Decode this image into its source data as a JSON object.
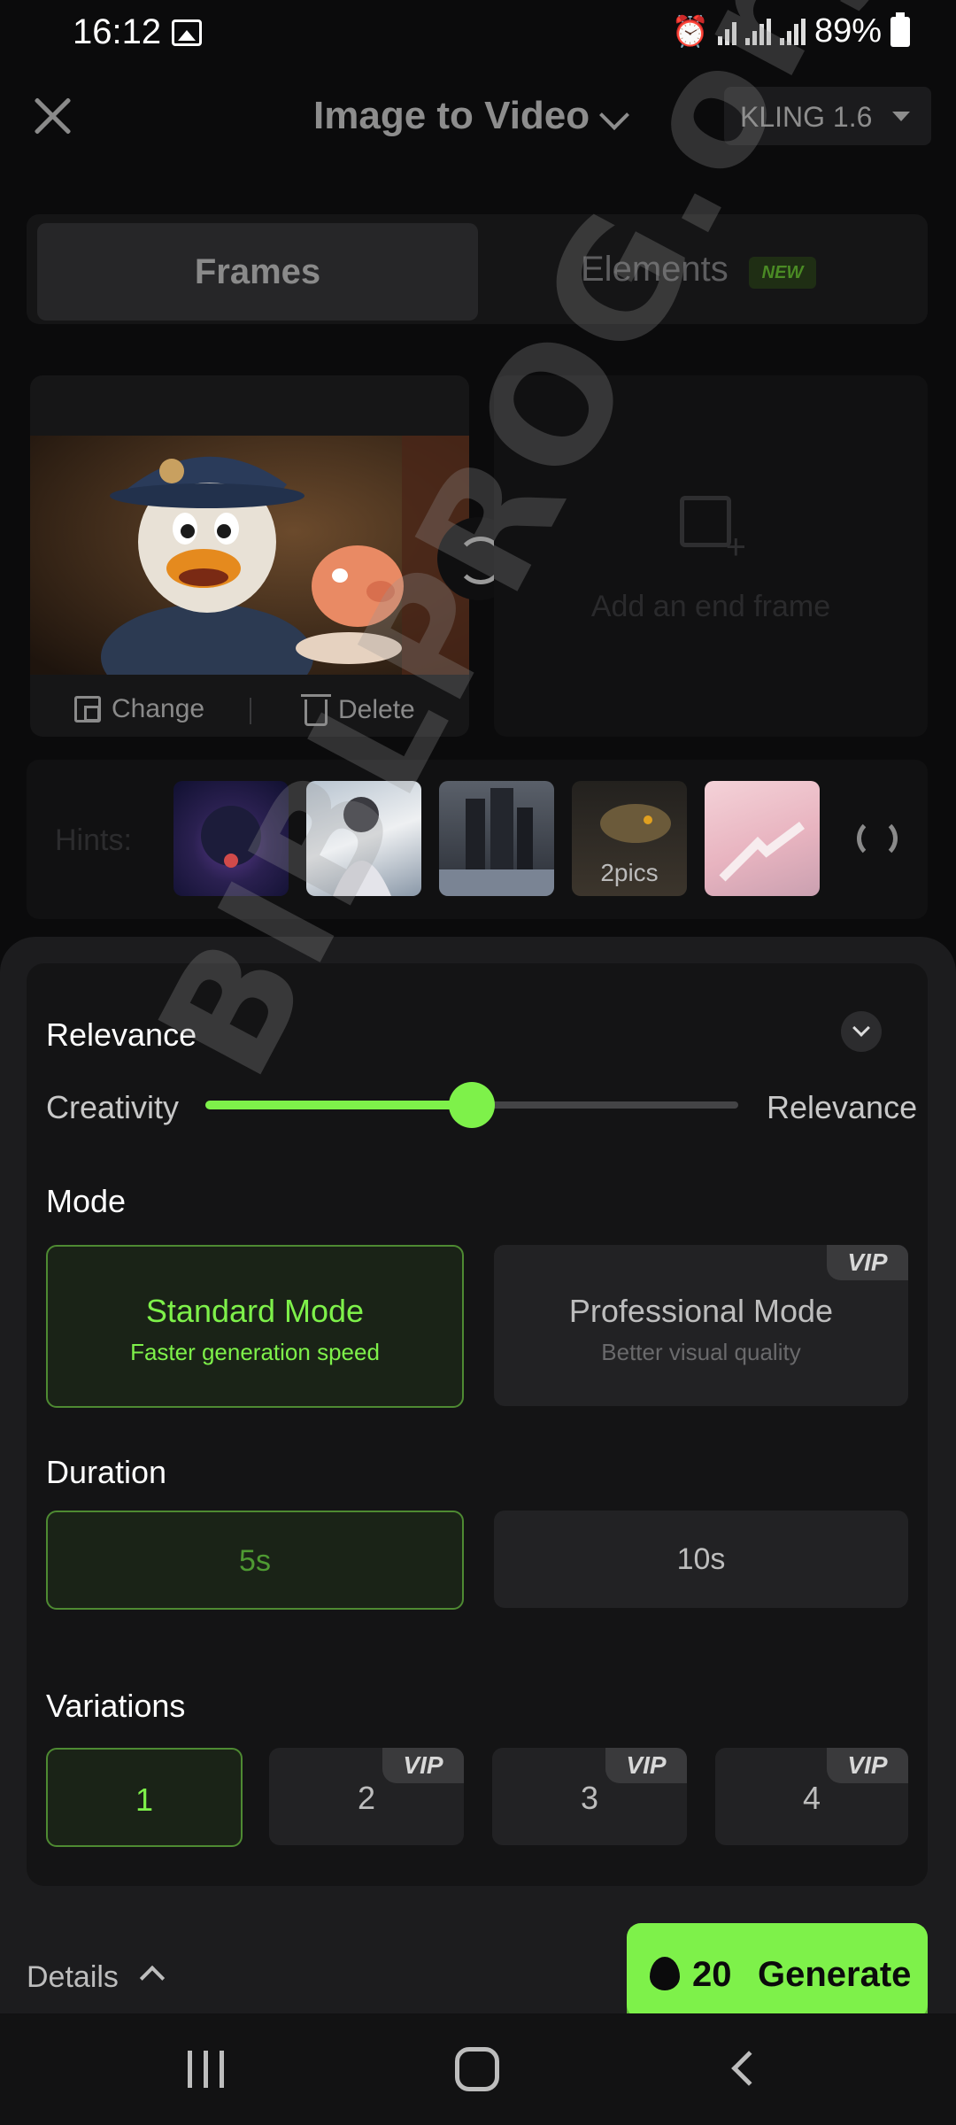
{
  "status_bar": {
    "time": "16:12",
    "battery": "89%"
  },
  "header": {
    "title": "Image to Video",
    "model": "KLING 1.6"
  },
  "tabs": [
    {
      "label": "Frames"
    },
    {
      "label": "Elements",
      "badge": "NEW"
    }
  ],
  "frames": {
    "change_label": "Change",
    "delete_label": "Delete",
    "add_end_frame": "Add an end frame"
  },
  "hints": {
    "label": "Hints:",
    "badge_text": "2pics"
  },
  "relevance": {
    "title": "Relevance",
    "left_label": "Creativity",
    "right_label": "Relevance",
    "value": 0.5
  },
  "mode": {
    "title": "Mode",
    "options": [
      {
        "title": "Standard Mode",
        "subtitle": "Faster generation speed"
      },
      {
        "title": "Professional Mode",
        "subtitle": "Better visual quality",
        "badge": "VIP"
      }
    ]
  },
  "duration": {
    "title": "Duration",
    "options": [
      "5s",
      "10s"
    ]
  },
  "variations": {
    "title": "Variations",
    "options": [
      "1",
      "2",
      "3",
      "4"
    ],
    "vip_badge": "VIP"
  },
  "footer": {
    "details_label": "Details",
    "cost": "20",
    "generate_label": "Generate"
  },
  "watermark": "BIBLPROG.org.ua",
  "colors": {
    "accent": "#7ef14a",
    "background": "#0b0b0c",
    "panel": "#141415"
  }
}
